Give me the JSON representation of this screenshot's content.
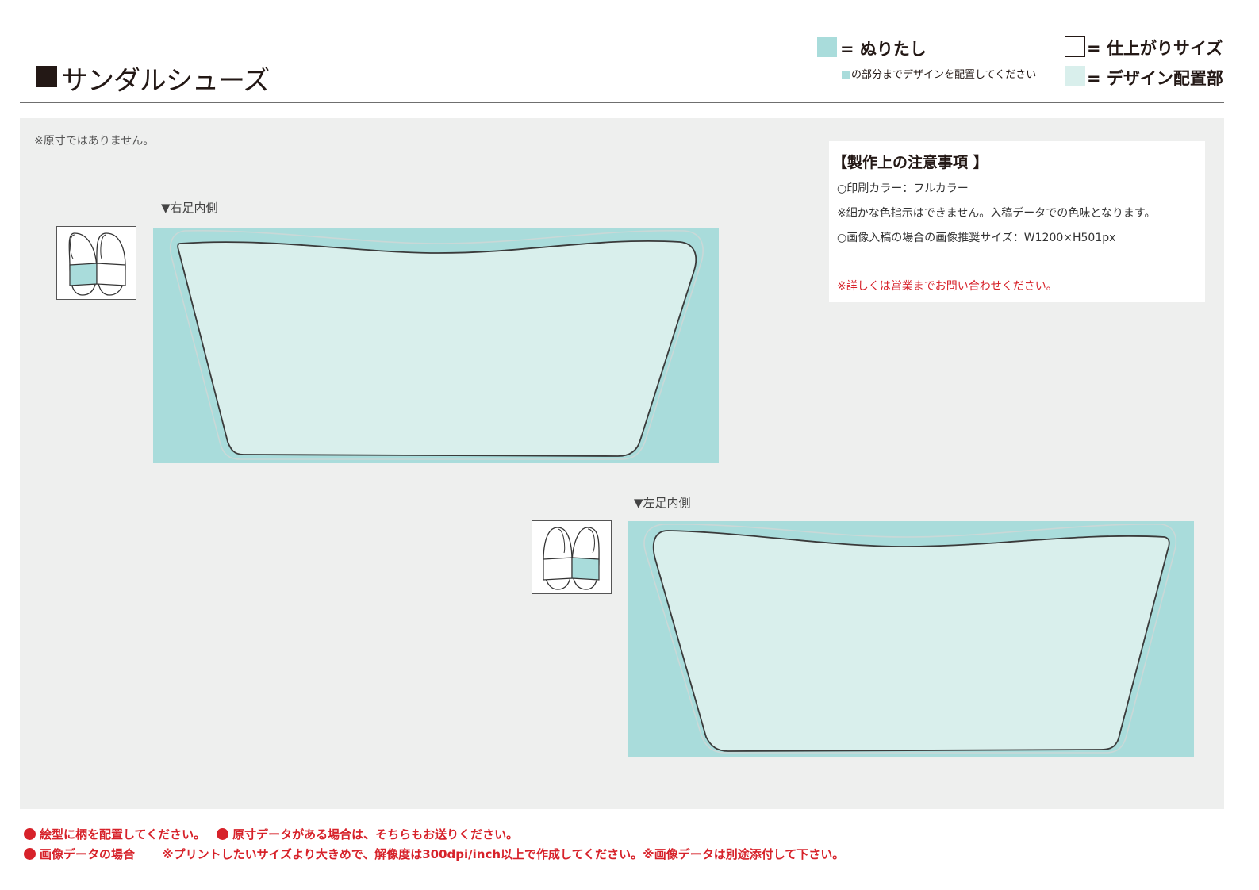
{
  "header": {
    "title": "サンダルシューズ"
  },
  "legend": {
    "bleed_label": "= ぬりたし",
    "bleed_note": "の部分までデザインを配置してください",
    "trim_label": "= 仕上がりサイズ",
    "design_label": "= デザイン配置部",
    "colors": {
      "bleed": "#a9dcdb",
      "design_area": "#d9efec",
      "trim": "#ffffff"
    }
  },
  "canvas": {
    "scale_note": "※原寸ではありません。",
    "right_panel_label": "▼右足内側",
    "left_panel_label": "▼左足内側",
    "thumb_icons": [
      "right-sandal-highlight-icon",
      "left-sandal-highlight-icon"
    ]
  },
  "notes": {
    "title": "【製作上の注意事項 】",
    "lines": [
      "○印刷カラー：フルカラー",
      "※細かな色指示はできません。入稿データでの色味となります。",
      "○画像入稿の場合の画像推奨サイズ：W1200×H501px",
      "※詳しくは営業までお問い合わせください。"
    ]
  },
  "footer": {
    "item1": "絵型に柄を配置してください。",
    "item2": "原寸データがある場合は、そちらもお送りください。",
    "item3": "画像データの場合",
    "item3_detail": "※プリントしたいサイズより大きめで、解像度は300dpi/inch以上で作成してください。※画像データは別途添付して下さい。",
    "accent_color": "#d7222a"
  }
}
